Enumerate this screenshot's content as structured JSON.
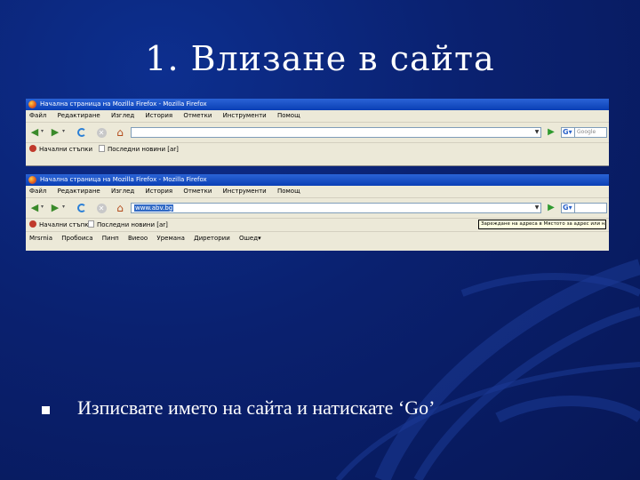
{
  "slide": {
    "title": "1. Влизане в сайта",
    "bullet": "Изписвате името на сайта и натискате ‘Go’"
  },
  "browser1": {
    "window_title": "Начална страница на Mozilla Firefox - Mozilla Firefox",
    "menu": [
      "Файл",
      "Редактиране",
      "Изглед",
      "История",
      "Отметки",
      "Инструменти",
      "Помощ"
    ],
    "url": "",
    "search_placeholder": "Google",
    "bookmarks": [
      "Начални стъпки",
      "Последни новини [ar]"
    ]
  },
  "browser2": {
    "window_title": "Начална страница на Mozilla Firefox - Mozilla Firefox",
    "menu": [
      "Файл",
      "Редактиране",
      "Изглед",
      "История",
      "Отметки",
      "Инструменти",
      "Помощ"
    ],
    "url": "www.abv.bg",
    "bookmarks": [
      "Начални стъпки",
      "Последни новини [ar]"
    ],
    "tooltip": "Зареждане на адреса в Мястото за адрес или натиснете Enter",
    "links": [
      "Mrsrnia",
      "Пробоиса",
      "Пинп",
      "Виеоо",
      "Уремана",
      "Диретории",
      "Ошед▾"
    ]
  },
  "icons": {
    "back": "back-arrow-icon",
    "forward": "forward-arrow-icon",
    "reload": "reload-icon",
    "stop": "stop-icon",
    "home": "home-icon",
    "go": "go-arrow-icon",
    "search_engine": "google-icon"
  },
  "colors": {
    "background": "#0a2170",
    "titlebar": "#0a3fb5",
    "chrome": "#ece9d8"
  }
}
